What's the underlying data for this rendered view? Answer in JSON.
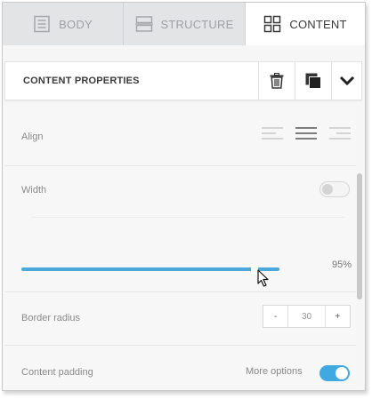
{
  "tabs": [
    {
      "label": "BODY",
      "icon": "document-icon",
      "active": false
    },
    {
      "label": "STRUCTURE",
      "icon": "structure-rows-icon",
      "active": false
    },
    {
      "label": "CONTENT",
      "icon": "grid-icon",
      "active": true
    }
  ],
  "properties": {
    "title": "CONTENT PROPERTIES",
    "actions": [
      "trash-icon",
      "duplicate-icon",
      "chevron-down-icon"
    ]
  },
  "align": {
    "label": "Align",
    "options": [
      "align-left-icon",
      "align-center-icon",
      "align-right-icon"
    ],
    "selected": "center"
  },
  "width": {
    "label": "Width",
    "toggle_on": false,
    "value_text": "95%",
    "value": 0.95
  },
  "border_radius": {
    "label": "Border radius",
    "minus": "-",
    "value": "30",
    "plus": "+"
  },
  "content_padding": {
    "label": "Content padding",
    "more_options_label": "More options",
    "toggle_on": true
  },
  "colors": {
    "accent": "#3fa9e0",
    "tab_inactive_bg": "#e3e4e6",
    "panel_bg": "#f7f7f7"
  }
}
